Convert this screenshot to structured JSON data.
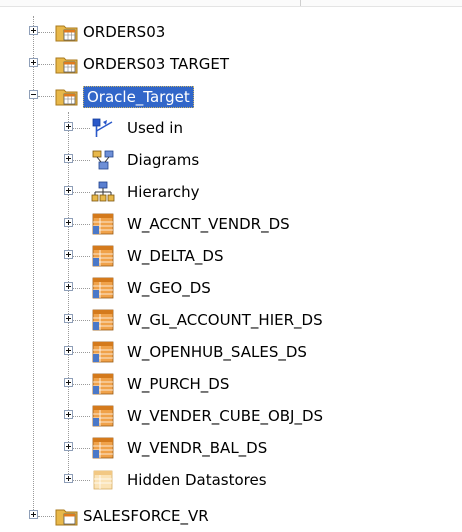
{
  "tree": {
    "top_items": [
      {
        "label": "ORDERS03",
        "icon": "datastore-folder-icon",
        "expander": "plus"
      },
      {
        "label": "ORDERS03 TARGET",
        "icon": "datastore-folder-icon",
        "expander": "plus"
      },
      {
        "label": "Oracle_Target",
        "icon": "datastore-folder-icon",
        "expander": "minus",
        "selected": true
      }
    ],
    "children": [
      {
        "label": "Used in",
        "icon": "used-in-icon"
      },
      {
        "label": "Diagrams",
        "icon": "diagrams-icon"
      },
      {
        "label": "Hierarchy",
        "icon": "hierarchy-icon"
      },
      {
        "label": "W_ACCNT_VENDR_DS",
        "icon": "table-icon"
      },
      {
        "label": "W_DELTA_DS",
        "icon": "table-icon"
      },
      {
        "label": "W_GEO_DS",
        "icon": "table-icon"
      },
      {
        "label": "W_GL_ACCOUNT_HIER_DS",
        "icon": "table-icon"
      },
      {
        "label": "W_OPENHUB_SALES_DS",
        "icon": "table-icon"
      },
      {
        "label": "W_PURCH_DS",
        "icon": "table-icon"
      },
      {
        "label": "W_VENDER_CUBE_OBJ_DS",
        "icon": "table-icon"
      },
      {
        "label": "W_VENDR_BAL_DS",
        "icon": "table-icon"
      },
      {
        "label": "Hidden Datastores",
        "icon": "hidden-datastores-icon"
      }
    ],
    "bottom_items": [
      {
        "label": "SALESFORCE_VR",
        "icon": "datastore-folder-icon",
        "expander": "plus"
      }
    ]
  },
  "colors": {
    "selection": "#3166c9",
    "folder": "#e8b84a",
    "table_orange": "#f0a24a",
    "table_blue": "#4a78c8"
  }
}
